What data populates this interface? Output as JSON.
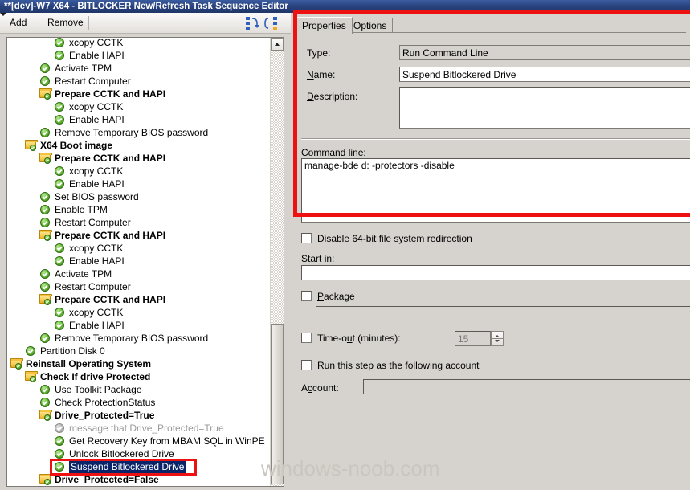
{
  "window": {
    "title": "**[dev]-W7 X64 - BITLOCKER New/Refresh Task Sequence Editor"
  },
  "toolbar": {
    "add_label": "Add",
    "remove_label": "Remove",
    "collapse_icon": "collapse-all-icon",
    "expand_icon": "expand-all-icon"
  },
  "tree": {
    "items": [
      {
        "label": "xcopy CCTK",
        "indent": 3,
        "type": "step",
        "state": "normal"
      },
      {
        "label": "Enable HAPI",
        "indent": 3,
        "type": "step",
        "state": "normal"
      },
      {
        "label": "Activate TPM",
        "indent": 2,
        "type": "step",
        "state": "normal"
      },
      {
        "label": "Restart Computer",
        "indent": 2,
        "type": "step",
        "state": "normal"
      },
      {
        "label": "Prepare CCTK and HAPI",
        "indent": 2,
        "type": "group",
        "state": "normal"
      },
      {
        "label": "xcopy CCTK",
        "indent": 3,
        "type": "step",
        "state": "normal"
      },
      {
        "label": "Enable HAPI",
        "indent": 3,
        "type": "step",
        "state": "normal"
      },
      {
        "label": "Remove Temporary BIOS password",
        "indent": 2,
        "type": "step",
        "state": "normal"
      },
      {
        "label": "X64 Boot image",
        "indent": 1,
        "type": "group",
        "state": "normal"
      },
      {
        "label": "Prepare CCTK and HAPI",
        "indent": 2,
        "type": "group",
        "state": "normal"
      },
      {
        "label": "xcopy CCTK",
        "indent": 3,
        "type": "step",
        "state": "normal"
      },
      {
        "label": "Enable HAPI",
        "indent": 3,
        "type": "step",
        "state": "normal"
      },
      {
        "label": "Set BIOS password",
        "indent": 2,
        "type": "step",
        "state": "normal"
      },
      {
        "label": "Enable TPM",
        "indent": 2,
        "type": "step",
        "state": "normal"
      },
      {
        "label": "Restart Computer",
        "indent": 2,
        "type": "step",
        "state": "normal"
      },
      {
        "label": "Prepare CCTK and HAPI",
        "indent": 2,
        "type": "group",
        "state": "normal"
      },
      {
        "label": "xcopy CCTK",
        "indent": 3,
        "type": "step",
        "state": "normal"
      },
      {
        "label": "Enable HAPI",
        "indent": 3,
        "type": "step",
        "state": "normal"
      },
      {
        "label": "Activate TPM",
        "indent": 2,
        "type": "step",
        "state": "normal"
      },
      {
        "label": "Restart Computer",
        "indent": 2,
        "type": "step",
        "state": "normal"
      },
      {
        "label": "Prepare CCTK and HAPI",
        "indent": 2,
        "type": "group",
        "state": "normal"
      },
      {
        "label": "xcopy CCTK",
        "indent": 3,
        "type": "step",
        "state": "normal"
      },
      {
        "label": "Enable HAPI",
        "indent": 3,
        "type": "step",
        "state": "normal"
      },
      {
        "label": "Remove Temporary BIOS password",
        "indent": 2,
        "type": "step",
        "state": "normal"
      },
      {
        "label": "Partition Disk 0",
        "indent": 1,
        "type": "step",
        "state": "normal"
      },
      {
        "label": "Reinstall Operating System",
        "indent": 0,
        "type": "group",
        "state": "normal"
      },
      {
        "label": "Check If drive Protected",
        "indent": 1,
        "type": "group",
        "state": "normal"
      },
      {
        "label": "Use Toolkit Package",
        "indent": 2,
        "type": "step",
        "state": "normal"
      },
      {
        "label": "Check ProtectionStatus",
        "indent": 2,
        "type": "step",
        "state": "normal"
      },
      {
        "label": "Drive_Protected=True",
        "indent": 2,
        "type": "group",
        "state": "normal"
      },
      {
        "label": "message that Drive_Protected=True",
        "indent": 3,
        "type": "step",
        "state": "disabled"
      },
      {
        "label": "Get Recovery Key from MBAM SQL in WinPE",
        "indent": 3,
        "type": "step",
        "state": "normal"
      },
      {
        "label": "Unlock Bitlockered Drive",
        "indent": 3,
        "type": "step",
        "state": "normal"
      },
      {
        "label": "Suspend Bitlockered Drive",
        "indent": 3,
        "type": "step",
        "state": "selected"
      },
      {
        "label": "Drive_Protected=False",
        "indent": 2,
        "type": "group",
        "state": "normal"
      }
    ]
  },
  "properties": {
    "tabs": [
      {
        "label": "Properties",
        "active": true
      },
      {
        "label": "Options",
        "active": false
      }
    ],
    "type_label": "Type:",
    "type_value": "Run Command Line",
    "name_label": "Name:",
    "name_value": "Suspend Bitlockered Drive",
    "description_label": "Description:",
    "description_value": "",
    "command_line_label": "Command line:",
    "command_line_value": "manage-bde d: -protectors -disable",
    "disable_redirection_label": "Disable 64-bit file system redirection",
    "disable_redirection_checked": false,
    "start_in_label": "Start in:",
    "start_in_value": "",
    "package_label": "Package",
    "package_checked": false,
    "package_value": "",
    "timeout_label": "Time-out (minutes):",
    "timeout_checked": false,
    "timeout_value": "15",
    "run_as_label": "Run this step as the following account",
    "run_as_checked": false,
    "account_label": "Account:",
    "account_value": ""
  },
  "annotations": {
    "watermark": "windows-noob.com",
    "highlight_color": "#ee1111",
    "selection_color": "#0a246a"
  }
}
